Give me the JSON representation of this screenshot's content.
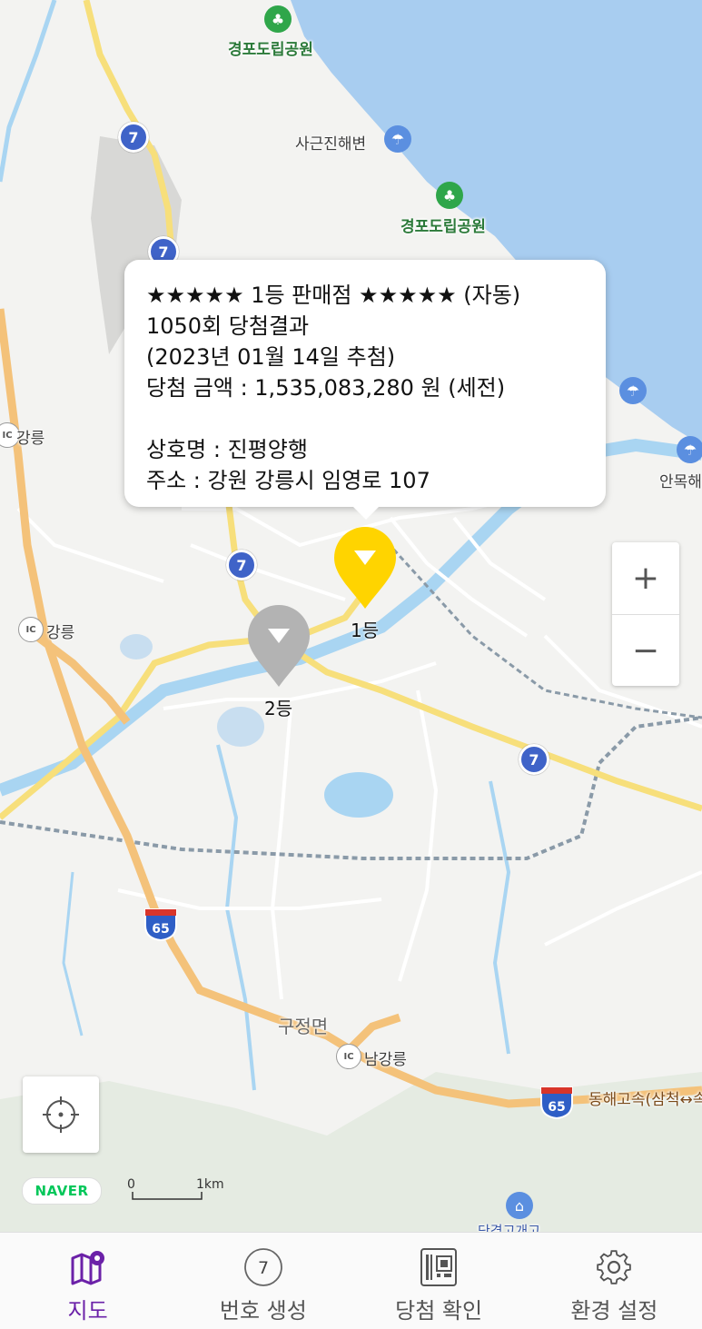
{
  "map": {
    "labels": {
      "park1": "경포도립공원",
      "beach": "사근진해변",
      "park2": "경포도립공원",
      "ic_gangneung1": "강릉",
      "ic_gangneung2": "강릉",
      "anmok": "안목해",
      "gujeong": "구정면",
      "namgangneung": "남강릉",
      "expressway": "동해고속(삼척↔속",
      "bottom_poi": "단경고개고"
    },
    "route_numbers": {
      "r7a": "7",
      "r7b": "7",
      "r7c": "7",
      "r7d": "7",
      "hw65a": "65",
      "hw65b": "65"
    },
    "ic_badge": "IC",
    "naver_logo": "NAVER",
    "scale": {
      "zero": "0",
      "dist": "1km"
    }
  },
  "popup": {
    "line1": "★★★★★ 1등 판매점 ★★★★★ (자동)",
    "line2": "1050회 당첨결과",
    "line3": "(2023년 01월 14일 추첨)",
    "line4": "당첨 금액 : 1,535,083,280 원 (세전)",
    "line5": "상호명 : 진평양행",
    "line6": "주소 : 강원 강릉시 임영로 107"
  },
  "pins": [
    {
      "label": "1등",
      "color": "#ffd400"
    },
    {
      "label": "2등",
      "color": "#b3b3b3"
    }
  ],
  "zoom": {
    "in": "+",
    "out": "−"
  },
  "nav": {
    "items": [
      {
        "label": "지도",
        "icon": "map-pin-icon",
        "active": true
      },
      {
        "label": "번호 생성",
        "icon": "number-ball-icon",
        "ball_number": "7"
      },
      {
        "label": "당첨 확인",
        "icon": "qr-scan-icon"
      },
      {
        "label": "환경 설정",
        "icon": "gear-icon"
      }
    ]
  },
  "colors": {
    "sea": "#a8cdf0",
    "road_yellow": "#f7df7b",
    "highway_orange": "#f4c27a",
    "river": "#a9d5f2",
    "accent": "#6b21a8"
  }
}
